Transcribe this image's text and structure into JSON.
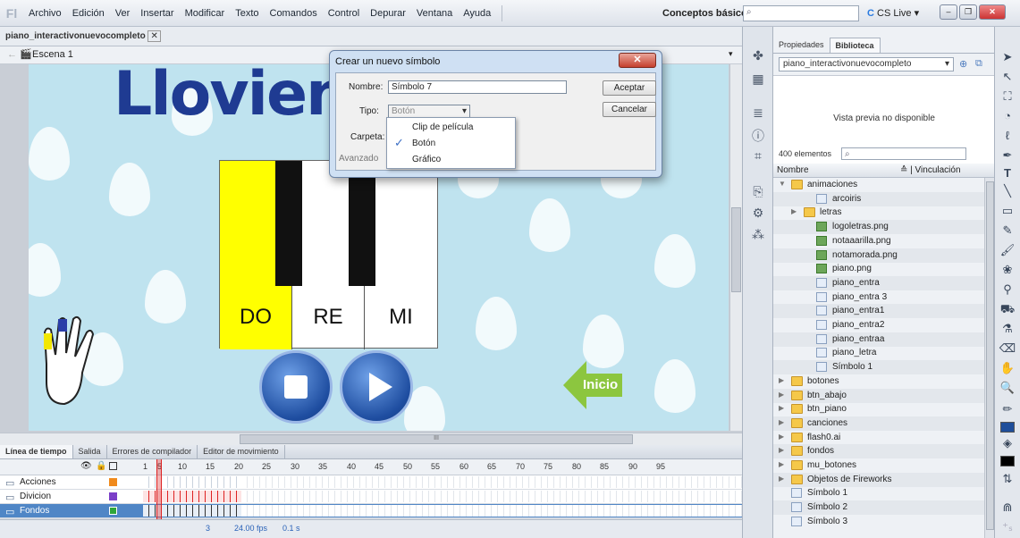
{
  "menubar": {
    "logo": "Fl",
    "items": [
      "Archivo",
      "Edición",
      "Ver",
      "Insertar",
      "Modificar",
      "Texto",
      "Comandos",
      "Control",
      "Depurar",
      "Ventana",
      "Ayuda"
    ],
    "workspace": "Conceptos básicos",
    "cslive": "CS Live"
  },
  "document": {
    "tab": "piano_interactivonuevocompleto",
    "scene": "Escena 1"
  },
  "stage": {
    "title": "Llovienc",
    "keys": [
      "DO",
      "RE",
      "MI"
    ],
    "inicio": "Inicio",
    "hscroll_indicator": "III"
  },
  "timeline": {
    "tabs": [
      "Línea de tiempo",
      "Salida",
      "Errores de compilador",
      "Editor de movimiento"
    ],
    "frame_numbers": [
      "1",
      "5",
      "10",
      "15",
      "20",
      "25",
      "30",
      "35",
      "40",
      "45",
      "50",
      "55",
      "60",
      "65",
      "70",
      "75",
      "80",
      "85",
      "90",
      "95"
    ],
    "layers": [
      "Acciones",
      "Divicion",
      "Fondos"
    ],
    "fps": "24.00 fps",
    "time": "0.1 s",
    "frame": "3"
  },
  "library": {
    "tabs": [
      "Propiedades",
      "Biblioteca"
    ],
    "selected": "piano_interactivonuevocompleto",
    "preview": "Vista previa no disponible",
    "count": "400 elementos",
    "col_name": "Nombre",
    "col_link": "Vinculación",
    "items": [
      {
        "name": "animaciones",
        "type": "folder",
        "depth": 0,
        "open": true
      },
      {
        "name": "arcoiris",
        "type": "symbol",
        "depth": 2
      },
      {
        "name": "letras",
        "type": "folder",
        "depth": 1
      },
      {
        "name": "logoletras.png",
        "type": "bitmap",
        "depth": 2
      },
      {
        "name": "notaaarilla.png",
        "type": "bitmap",
        "depth": 2
      },
      {
        "name": "notamorada.png",
        "type": "bitmap",
        "depth": 2
      },
      {
        "name": "piano.png",
        "type": "bitmap",
        "depth": 2
      },
      {
        "name": "piano_entra",
        "type": "symbol",
        "depth": 2
      },
      {
        "name": "piano_entra 3",
        "type": "symbol",
        "depth": 2
      },
      {
        "name": "piano_entra1",
        "type": "symbol",
        "depth": 2
      },
      {
        "name": "piano_entra2",
        "type": "symbol",
        "depth": 2
      },
      {
        "name": "piano_entraa",
        "type": "symbol",
        "depth": 2
      },
      {
        "name": "piano_letra",
        "type": "symbol",
        "depth": 2
      },
      {
        "name": "Símbolo 1",
        "type": "symbol",
        "depth": 2
      },
      {
        "name": "botones",
        "type": "folder",
        "depth": 0
      },
      {
        "name": "btn_abajo",
        "type": "folder",
        "depth": 0
      },
      {
        "name": "btn_piano",
        "type": "folder",
        "depth": 0
      },
      {
        "name": "canciones",
        "type": "folder",
        "depth": 0
      },
      {
        "name": "flash0.ai",
        "type": "folder",
        "depth": 0
      },
      {
        "name": "fondos",
        "type": "folder",
        "depth": 0
      },
      {
        "name": "mu_botones",
        "type": "folder",
        "depth": 0
      },
      {
        "name": "Objetos de Fireworks",
        "type": "folder",
        "depth": 0
      },
      {
        "name": "Símbolo 1",
        "type": "symbol",
        "depth": 0
      },
      {
        "name": "Símbolo 2",
        "type": "symbol",
        "depth": 0
      },
      {
        "name": "Símbolo 3",
        "type": "symbol",
        "depth": 0
      }
    ]
  },
  "dialog": {
    "title": "Crear un nuevo símbolo",
    "name_label": "Nombre:",
    "name_value": "Símbolo 7",
    "type_label": "Tipo:",
    "type_value": "Botón",
    "folder_label": "Carpeta:",
    "advanced_label": "Avanzado",
    "ok": "Aceptar",
    "cancel": "Cancelar",
    "options": [
      "Clip de película",
      "Botón",
      "Gráfico"
    ],
    "checked": "Botón"
  }
}
